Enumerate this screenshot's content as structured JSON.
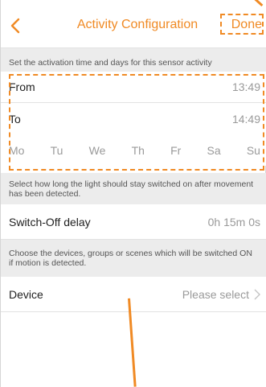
{
  "header": {
    "title": "Activity Configuration",
    "back_icon": "chevron-left-icon",
    "done_label": "Done"
  },
  "schedule": {
    "description": "Set the activation time and days for this sensor activity",
    "from_label": "From",
    "from_value": "13:49",
    "to_label": "To",
    "to_value": "14:49",
    "days": [
      "Mo",
      "Tu",
      "We",
      "Th",
      "Fr",
      "Sa",
      "Su"
    ]
  },
  "switch_off": {
    "description": "Select how long the light should stay switched on after movement has been detected.",
    "label": "Switch-Off delay",
    "value": "0h 15m 0s"
  },
  "device": {
    "description": "Choose the devices, groups or scenes which will be switched ON if motion is detected.",
    "label": "Device",
    "value": "Please select",
    "chevron_icon": "chevron-right-icon"
  },
  "colors": {
    "accent": "#f08a24",
    "section_bg": "#ececec",
    "muted_text": "#9a9a9a"
  }
}
